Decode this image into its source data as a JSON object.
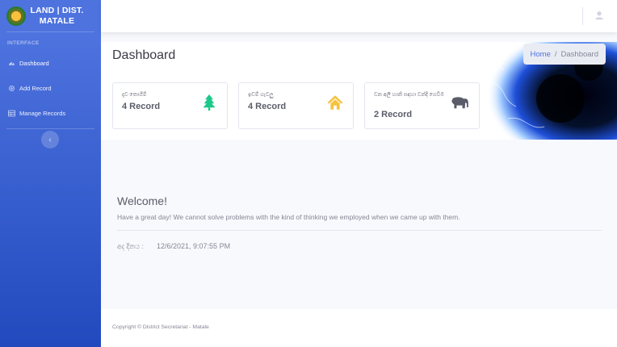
{
  "sidebar": {
    "brand": "LAND | DIST. MATALE",
    "heading": "INTERFACE",
    "items": [
      {
        "label": "Dashboard",
        "icon": "gauge-icon"
      },
      {
        "label": "Add Record",
        "icon": "gear-icon"
      },
      {
        "label": "Manage Records",
        "icon": "table-icon"
      }
    ],
    "toggle": "‹"
  },
  "page": {
    "title": "Dashboard",
    "breadcrumb": {
      "home": "Home",
      "separator": "/",
      "current": "Dashboard"
    }
  },
  "cards": [
    {
      "label": "දැව තොගීම්",
      "value": "4 Record",
      "icon": "tree-icon",
      "color": "#1cc88a"
    },
    {
      "label": "ඉඩම් ගැටලු",
      "value": "4 Record",
      "icon": "house-icon",
      "color": "#f6c23e"
    },
    {
      "label": "වන අලි හානි සඳහා වන්දි ගෙවීම",
      "value": "2 Record",
      "icon": "elephant-icon",
      "color": "#5a5c69"
    }
  ],
  "welcome": {
    "title": "Welcome!",
    "message": "Have a great day! We cannot solve problems with the kind of thinking we employed when we came up with them.",
    "date_label": "අද දිනය :",
    "date_value": "12/6/2021, 9:07:55 PM"
  },
  "footer": "Copyright © District Secretariat - Matale",
  "colors": {
    "primary": "#4e73df",
    "sidebar_dark": "#224abe"
  }
}
